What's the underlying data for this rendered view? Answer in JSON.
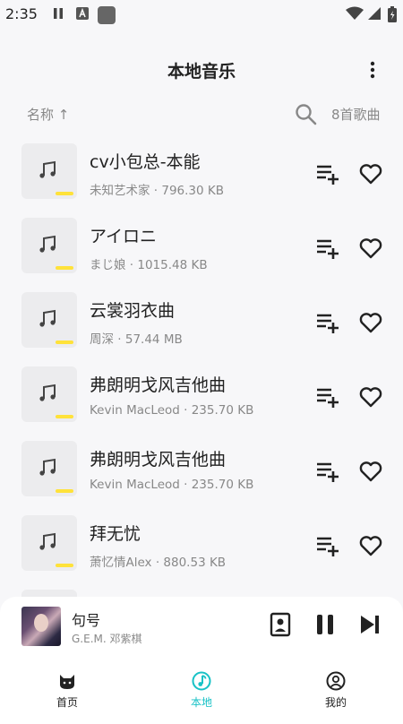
{
  "status_bar": {
    "time": "2:35"
  },
  "app_bar": {
    "title": "本地音乐",
    "menu_icon": "more-vert-icon"
  },
  "sort_bar": {
    "sort_label": "名称 ↑",
    "count_label": "8首歌曲",
    "search_icon": "search-icon"
  },
  "songs": [
    {
      "title": "cv小包总-本能",
      "subtitle": "未知艺术家 · 796.30 KB"
    },
    {
      "title": "アイロニ",
      "subtitle": "まじ娘 · 1015.48 KB"
    },
    {
      "title": "云裳羽衣曲",
      "subtitle": "周深 · 57.44 MB"
    },
    {
      "title": "弗朗明戈风吉他曲",
      "subtitle": "Kevin MacLeod · 235.70 KB"
    },
    {
      "title": "弗朗明戈风吉他曲",
      "subtitle": "Kevin MacLeod · 235.70 KB"
    },
    {
      "title": "拜无忧",
      "subtitle": "萧忆情Alex · 880.53 KB"
    }
  ],
  "player": {
    "title": "句号",
    "artist": "G.E.M. 邓紫棋",
    "state": "playing"
  },
  "bottom_nav": [
    {
      "label": "首页",
      "icon": "cat-icon",
      "active": false
    },
    {
      "label": "本地",
      "icon": "music-note-icon",
      "active": true
    },
    {
      "label": "我的",
      "icon": "user-circle-icon",
      "active": false
    }
  ],
  "colors": {
    "accent": "#18c2c6",
    "highlight_bar": "#ffe23a",
    "background": "#f7f7f9"
  }
}
